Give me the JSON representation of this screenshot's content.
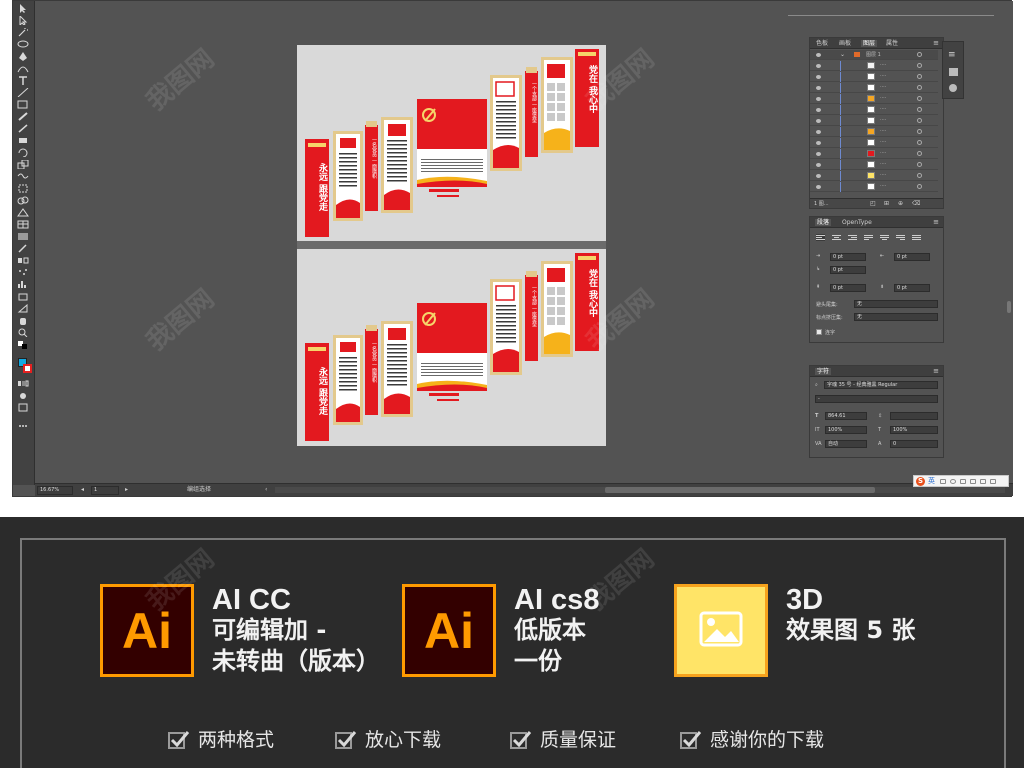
{
  "app": {
    "zoom": "16.67%",
    "artboard_index": "1",
    "status_text": "编组选择",
    "colors": {
      "ui_bg": "#535353",
      "panel_dark": "#424242",
      "fill": "#12a8e0",
      "stroke": "#e62020"
    }
  },
  "artboards": [
    {
      "slogan_left": "永远 跟党走",
      "slogan_right": "党在 我心中",
      "mid_slogan_a": "一名党员 一面旗帜",
      "mid_slogan_b": "一个支部 一座堡垒"
    },
    {
      "slogan_left": "永远 跟党走",
      "slogan_right": "党在 我心中",
      "mid_slogan_a": "一名党员 一面旗帜",
      "mid_slogan_b": "一个支部 一座堡垒"
    }
  ],
  "layers_panel": {
    "tabs": [
      "色板",
      "画板",
      "图层",
      "属性"
    ],
    "active_tab": "图层",
    "top_layer_name": "图层 1",
    "sublayer_names": [
      "····",
      "····",
      "····",
      "····",
      "····",
      "····",
      "····",
      "····",
      "····",
      "····",
      "····",
      "····"
    ],
    "footer": "1 图..."
  },
  "paragraph_panel": {
    "tabs": [
      "段落",
      "OpenType"
    ],
    "fields": [
      "0 pt",
      "0 pt",
      "0 pt",
      "0 pt",
      "0 pt",
      "0 pt"
    ],
    "kinsoku_label": "避头尾集:",
    "kinsoku_value": "无",
    "mojikumi_label": "标点挤压集:",
    "mojikumi_value": "无",
    "hyphenate_label": "连字"
  },
  "character_panel": {
    "tab": "字符",
    "font_family": "字魂 35 号 - 经典雅黑 Regular",
    "font_style": "-",
    "size": "864.61",
    "tracking": "",
    "vscale": "100%",
    "hscale": "100%",
    "leading": "自动",
    "baseline": "0"
  },
  "ime": {
    "lang": "英"
  },
  "banner": {
    "features": [
      {
        "icon_text": "Ai",
        "title": "AI CC",
        "lines": [
          "可编辑加 -",
          "未转曲（版本）"
        ]
      },
      {
        "icon_text": "Ai",
        "title": "AI cs8",
        "lines": [
          "低版本",
          "一份"
        ]
      },
      {
        "icon_text": "image-icon",
        "title": "3D",
        "lines": [
          "效果图 5 张"
        ]
      }
    ],
    "checks": [
      "两种格式",
      "放心下载",
      "质量保证",
      "感谢你的下载"
    ],
    "colors": {
      "ai_border": "#ff9a00",
      "ai_bg": "#330000",
      "img_bg": "#ffe467",
      "banner_bg": "#2b2b2b"
    }
  },
  "watermark": "我图网"
}
